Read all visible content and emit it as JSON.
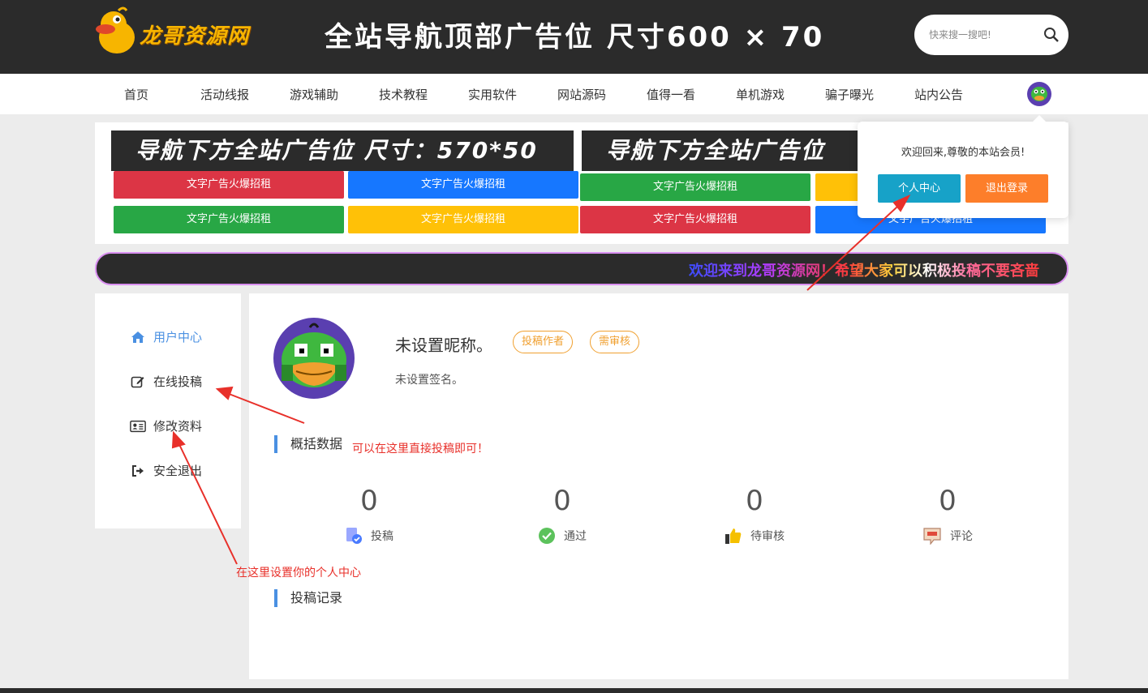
{
  "header": {
    "logo_text": "龙哥资源网",
    "top_ad": "全站导航顶部广告位 尺寸600 × 70",
    "search_placeholder": "快来搜一搜吧!"
  },
  "nav": {
    "items": [
      "首页",
      "活动线报",
      "游戏辅助",
      "技术教程",
      "实用软件",
      "网站源码",
      "值得一看",
      "单机游戏",
      "骗子曝光",
      "站内公告"
    ]
  },
  "ads": {
    "banner_1": "导航下方全站广告位 尺寸：570*50",
    "banner_2": "导航下方全站广告位",
    "text_ad_label": "文字广告火爆招租",
    "text_ad_label_4": "文字广告火爆招租"
  },
  "marquee": {
    "text": "欢迎来到龙哥资源网！希望大家可以积极投稿不要吝啬"
  },
  "popup": {
    "message": "欢迎回来,尊敬的本站会员!",
    "user_center": "个人中心",
    "logout": "退出登录"
  },
  "sidebar": {
    "items": [
      "用户中心",
      "在线投稿",
      "修改资料",
      "安全退出"
    ]
  },
  "profile": {
    "nickname": "未设置昵称。",
    "badge_author": "投稿作者",
    "badge_review": "需审核",
    "signature": "未设置签名。"
  },
  "overview": {
    "title": "概括数据",
    "stats": [
      {
        "value": "0",
        "label": "投稿"
      },
      {
        "value": "0",
        "label": "通过"
      },
      {
        "value": "0",
        "label": "待审核"
      },
      {
        "value": "0",
        "label": "评论"
      }
    ]
  },
  "records": {
    "title": "投稿记录"
  },
  "annotations": {
    "submit_hint": "可以在这里直接投稿即可！",
    "profile_hint": "在这里设置你的个人中心"
  },
  "colors": {
    "accent": "#4a90e2",
    "badge": "#f0a030",
    "user_center_btn": "#17a2c8",
    "logout_btn": "#fd7e2a",
    "annotation": "#e8302a"
  }
}
